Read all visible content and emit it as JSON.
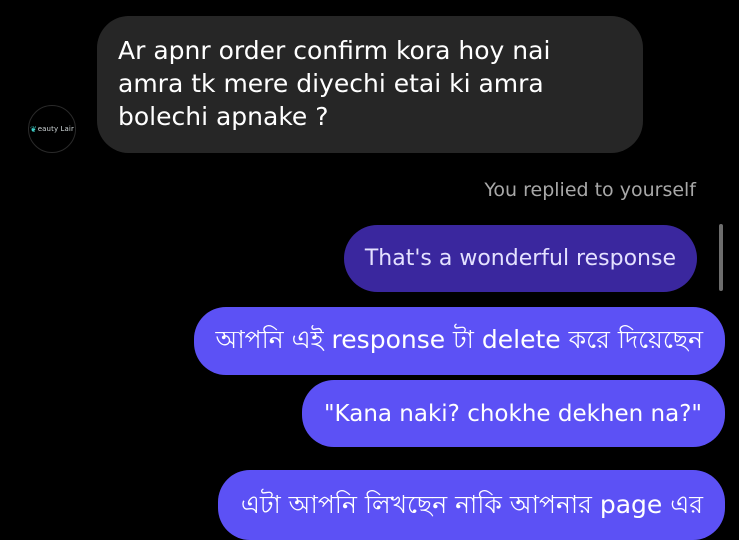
{
  "contact": {
    "avatar_leaf": "❦",
    "avatar_label": "eauty Lair"
  },
  "messages": [
    {
      "sender": "contact",
      "text": "Ar apnr order confirm kora hoy nai amra tk mere diyechi etai ki amra bolechi apnake ?"
    },
    {
      "sender": "self",
      "reply_note": "You replied to yourself",
      "replied_text": "That's a wonderful response"
    },
    {
      "sender": "self",
      "text": "আপনি এই response টা delete করে দিয়েছেন"
    },
    {
      "sender": "self",
      "text": "\"Kana naki? chokhe dekhen na?\""
    },
    {
      "sender": "self",
      "text": "এটা আপনি লিখছেন নাকি আপনার page এর"
    }
  ],
  "colors": {
    "background": "#000000",
    "incoming_bubble": "#262626",
    "outgoing_bubble": "#5c51f5",
    "replied_bubble": "#3a279e",
    "meta_text": "#a8a8a8"
  },
  "icons": {
    "avatar": "beauty-lair-logo"
  }
}
